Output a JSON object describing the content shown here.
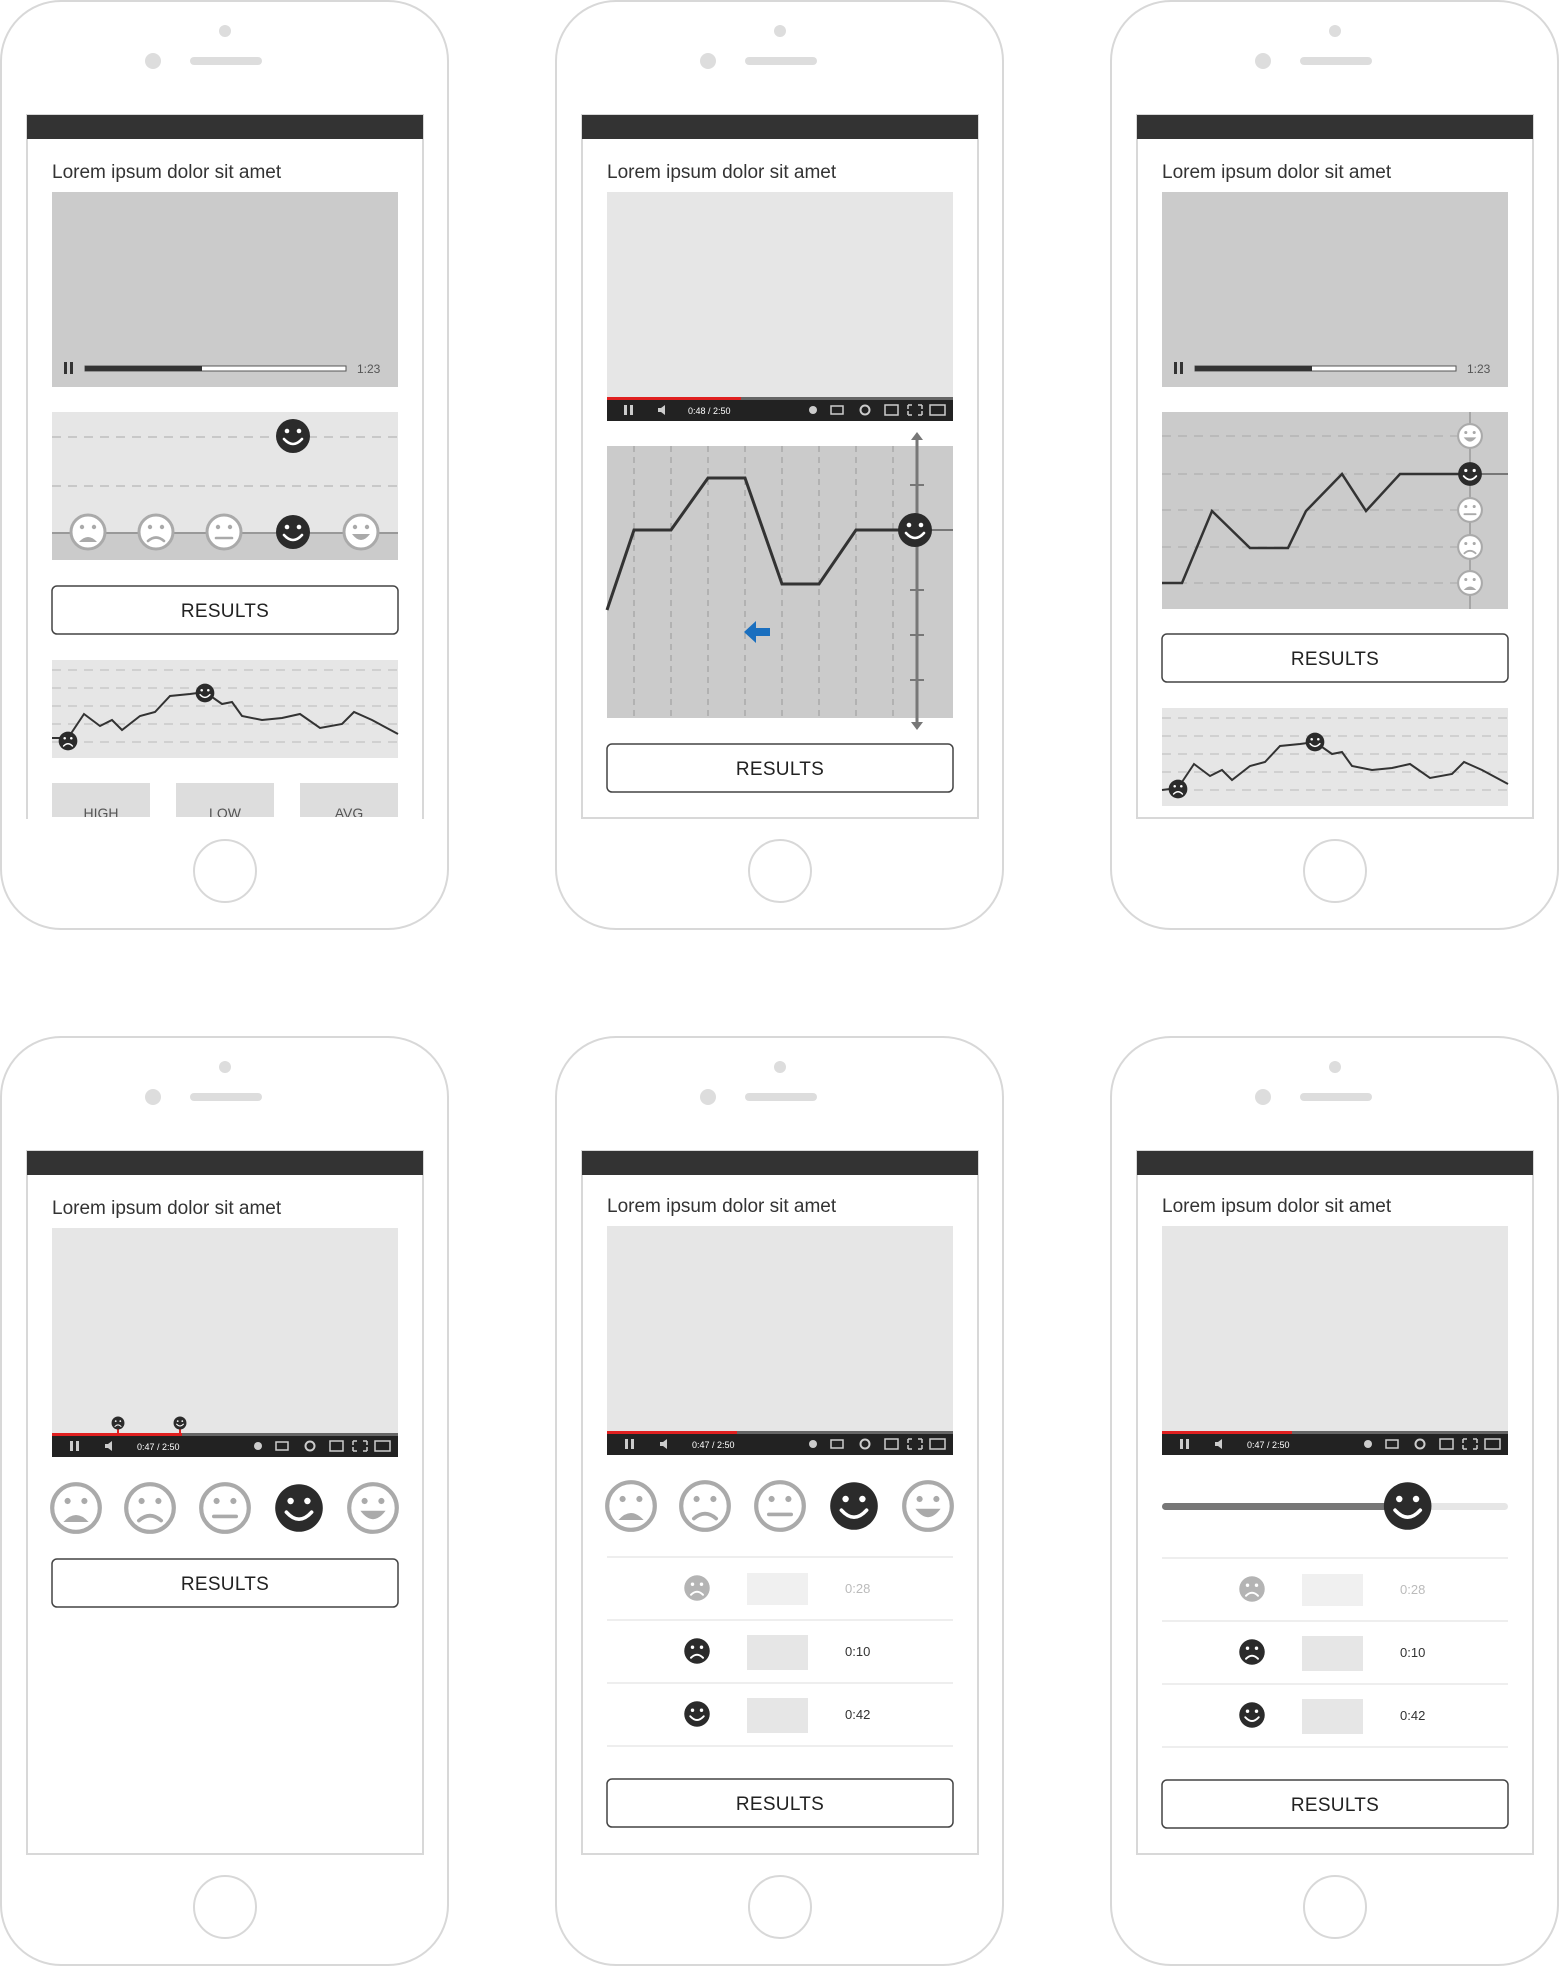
{
  "screens": [
    {
      "title": "Lorem ipsum dolor sit amet",
      "player_time": "1:23",
      "results_label": "RESULTS",
      "stat_tabs": [
        "HIGH",
        "LOW",
        "AVG"
      ]
    },
    {
      "title": "Lorem ipsum dolor sit amet",
      "player_time": "0:48 / 2:50",
      "results_label": "RESULTS"
    },
    {
      "title": "Lorem ipsum dolor sit amet",
      "player_time": "1:23",
      "results_label": "RESULTS"
    },
    {
      "title": "Lorem ipsum dolor sit amet",
      "player_time": "0:47 / 2:50",
      "results_label": "RESULTS"
    },
    {
      "title": "Lorem ipsum dolor sit amet",
      "player_time": "0:47 / 2:50",
      "results_label": "RESULTS",
      "reactions": [
        {
          "icon": "frown-face-icon",
          "time": "0:28",
          "faded": true
        },
        {
          "icon": "frown-face-icon",
          "time": "0:10",
          "faded": false
        },
        {
          "icon": "smile-face-icon",
          "time": "0:42",
          "faded": false
        }
      ]
    },
    {
      "title": "Lorem ipsum dolor sit amet",
      "player_time": "0:47 / 2:50",
      "results_label": "RESULTS",
      "slider_value": 0.71,
      "reactions": [
        {
          "icon": "frown-face-icon",
          "time": "0:28",
          "faded": true
        },
        {
          "icon": "frown-face-icon",
          "time": "0:10",
          "faded": false
        },
        {
          "icon": "smile-face-icon",
          "time": "0:42",
          "faded": false
        }
      ]
    }
  ],
  "emotion_scale": [
    "very-sad-face-icon",
    "sad-face-icon",
    "neutral-face-icon",
    "smile-face-icon",
    "big-smile-face-icon"
  ],
  "colors": {
    "frame": "#d8d8d8",
    "header_bar": "#333333",
    "video_gray": "#cbcbcb",
    "video_light": "#e6e6e6",
    "progress_red": "#e02020",
    "arrow_blue": "#1a6fbf",
    "face_dark": "#2b2b2b"
  }
}
